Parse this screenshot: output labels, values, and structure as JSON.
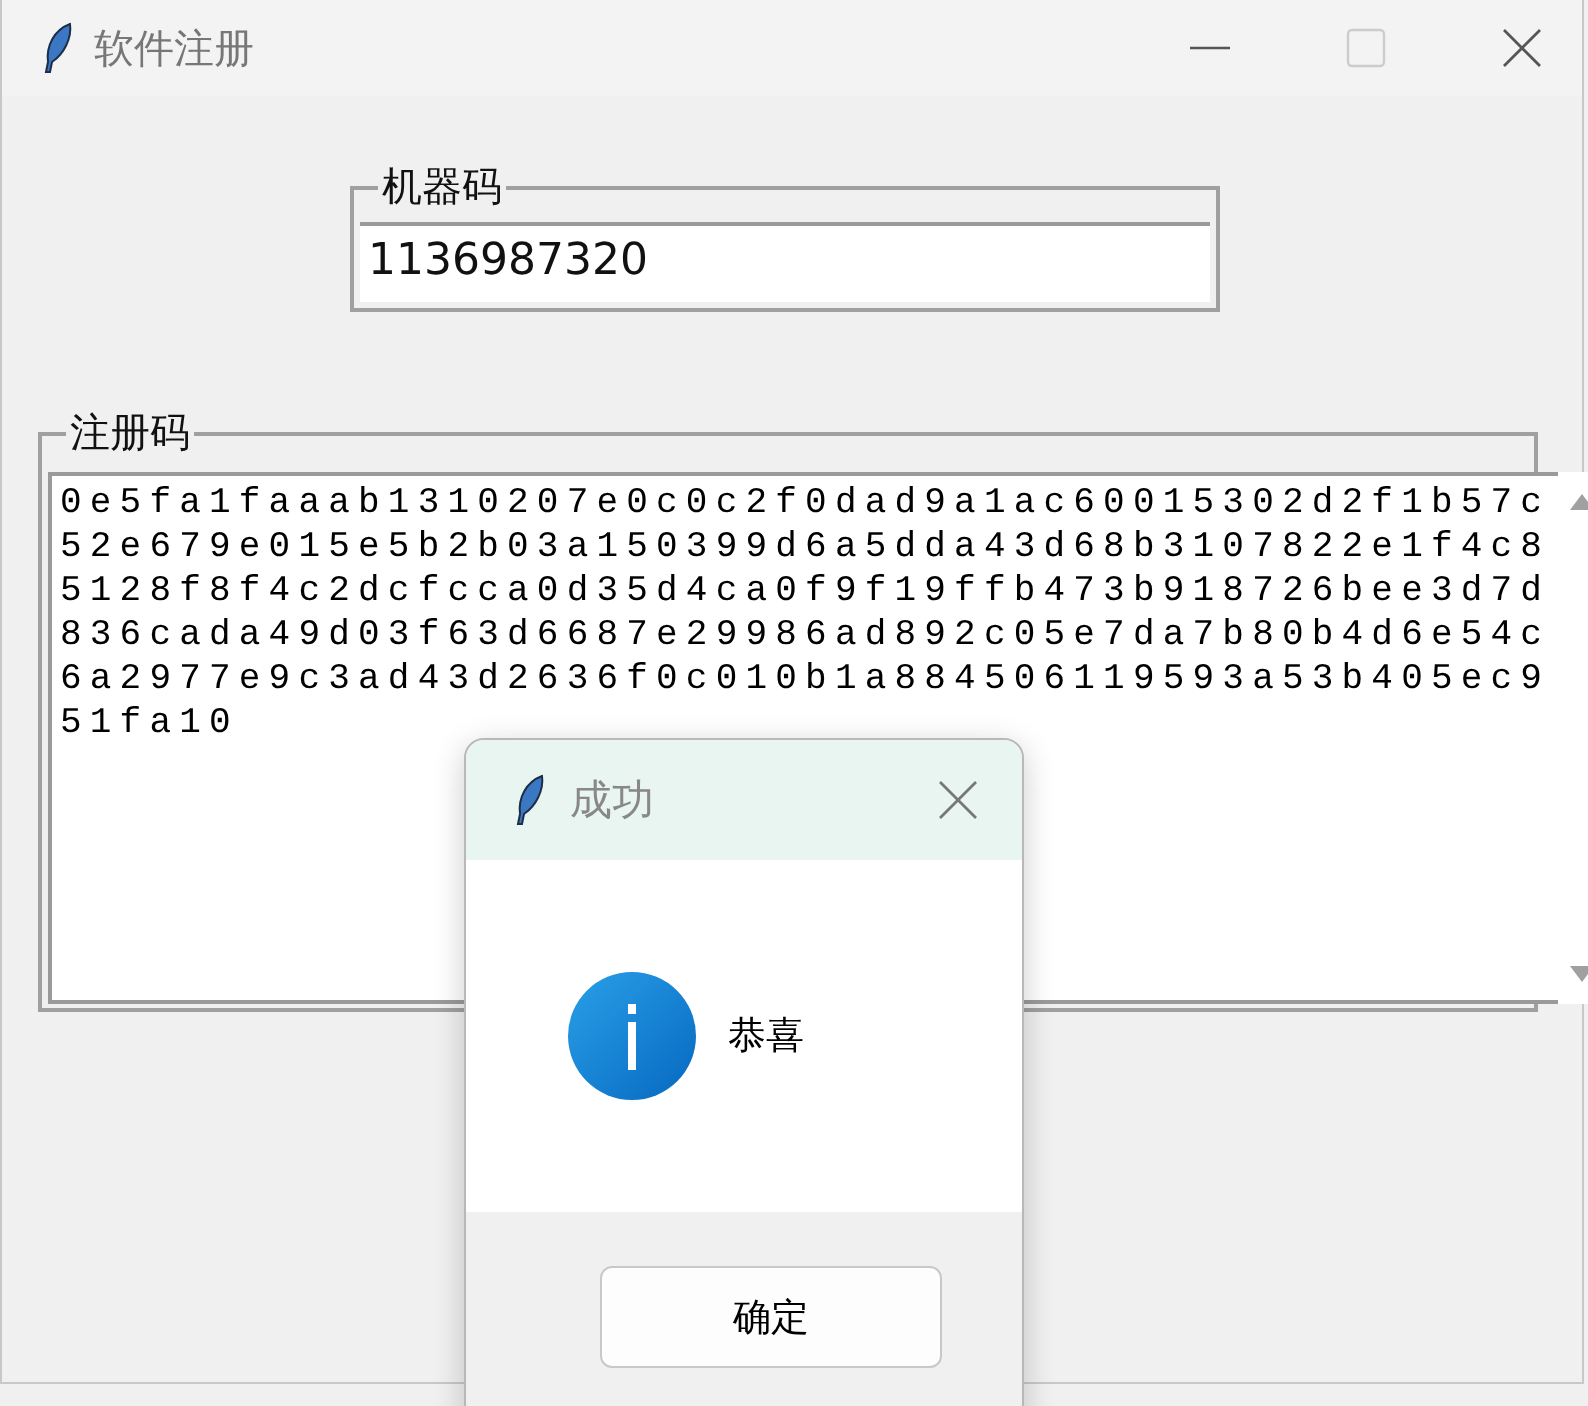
{
  "window": {
    "title": "软件注册"
  },
  "machine_code": {
    "label": "机器码",
    "value": "1136987320"
  },
  "registration_code": {
    "label": "注册码",
    "lines": [
      "0e5fa1faaab1310207e0c0c2f0dad9a1ac60015302d2f1b57c",
      "52e679e015e5b2b03a150399d6a5dda43d68b3107822e1f4c8",
      "5128f8f4c2dcfcca0d35d4ca0f9f19ffb473b918726bee3d7d",
      "836cada49d03f63d6687e29986ad892c05e7da7b80b4d6e54c",
      "6a2977e9c3ad43d2636f0c010b1a884506119593a53b405ec9",
      "51fa10"
    ]
  },
  "dialog": {
    "title": "成功",
    "message": "恭喜",
    "button": "确定"
  }
}
